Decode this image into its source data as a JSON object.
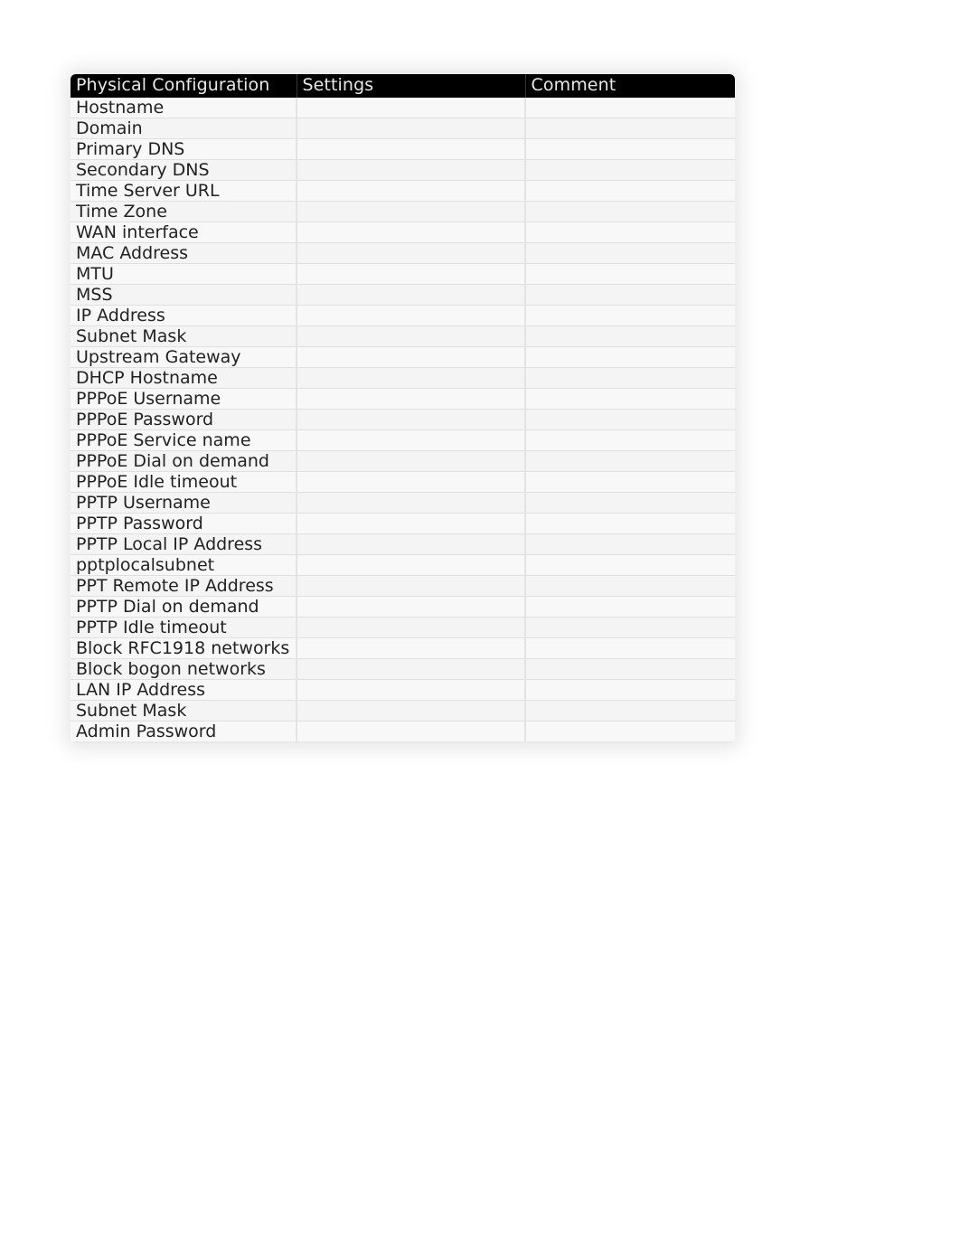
{
  "table": {
    "headers": {
      "col1": "Physical Configuration",
      "col2": "Settings",
      "col3": "Comment"
    },
    "rows": [
      {
        "label": "Hostname",
        "settings": "",
        "comment": "",
        "dim": false
      },
      {
        "label": "Domain",
        "settings": "",
        "comment": "",
        "dim": false
      },
      {
        "label": "Primary DNS",
        "settings": "",
        "comment": "",
        "dim": false
      },
      {
        "label": "Secondary DNS",
        "settings": "",
        "comment": "",
        "dim": false
      },
      {
        "label": "Time Server URL",
        "settings": "",
        "comment": "",
        "dim": false
      },
      {
        "label": "Time Zone",
        "settings": "",
        "comment": "",
        "dim": false
      },
      {
        "label": "WAN interface",
        "settings": "",
        "comment": "",
        "dim": false
      },
      {
        "label": "MAC Address",
        "settings": "",
        "comment": "",
        "dim": false
      },
      {
        "label": "MTU",
        "settings": "",
        "comment": "",
        "dim": false
      },
      {
        "label": "MSS",
        "settings": "",
        "comment": "",
        "dim": false
      },
      {
        "label": "IP Address",
        "settings": "",
        "comment": "",
        "dim": false
      },
      {
        "label": "Subnet Mask",
        "settings": "",
        "comment": "",
        "dim": false
      },
      {
        "label": "Upstream Gateway",
        "settings": "",
        "comment": "",
        "dim": false
      },
      {
        "label": "DHCP Hostname",
        "settings": "",
        "comment": "",
        "dim": false
      },
      {
        "label": "PPPoE Username",
        "settings": "",
        "comment": "",
        "dim": false
      },
      {
        "label": "PPPoE Password",
        "settings": "",
        "comment": "",
        "dim": true
      },
      {
        "label": "PPPoE Service name",
        "settings": "",
        "comment": "",
        "dim": true
      },
      {
        "label": "PPPoE Dial on demand",
        "settings": "",
        "comment": "",
        "dim": true
      },
      {
        "label": "PPPoE Idle timeout",
        "settings": "",
        "comment": "",
        "dim": true
      },
      {
        "label": "PPTP Username",
        "settings": "",
        "comment": "",
        "dim": false
      },
      {
        "label": "PPTP Password",
        "settings": "",
        "comment": "",
        "dim": true
      },
      {
        "label": "PPTP Local IP Address",
        "settings": "",
        "comment": "",
        "dim": true
      },
      {
        "label": "pptplocalsubnet",
        "settings": "",
        "comment": "",
        "dim": true
      },
      {
        "label": "PPT Remote IP Address",
        "settings": "",
        "comment": "",
        "dim": true
      },
      {
        "label": "PPTP Dial on demand",
        "settings": "",
        "comment": "",
        "dim": true
      },
      {
        "label": "PPTP Idle timeout",
        "settings": "",
        "comment": "",
        "dim": true
      },
      {
        "label": "Block RFC1918 networks",
        "settings": "",
        "comment": "",
        "dim": false
      },
      {
        "label": "Block bogon networks",
        "settings": "",
        "comment": "",
        "dim": false
      },
      {
        "label": "LAN IP Address",
        "settings": "",
        "comment": "",
        "dim": false
      },
      {
        "label": "Subnet Mask",
        "settings": "",
        "comment": "",
        "dim": false
      },
      {
        "label": "Admin Password",
        "settings": "",
        "comment": "",
        "dim": false
      }
    ]
  }
}
